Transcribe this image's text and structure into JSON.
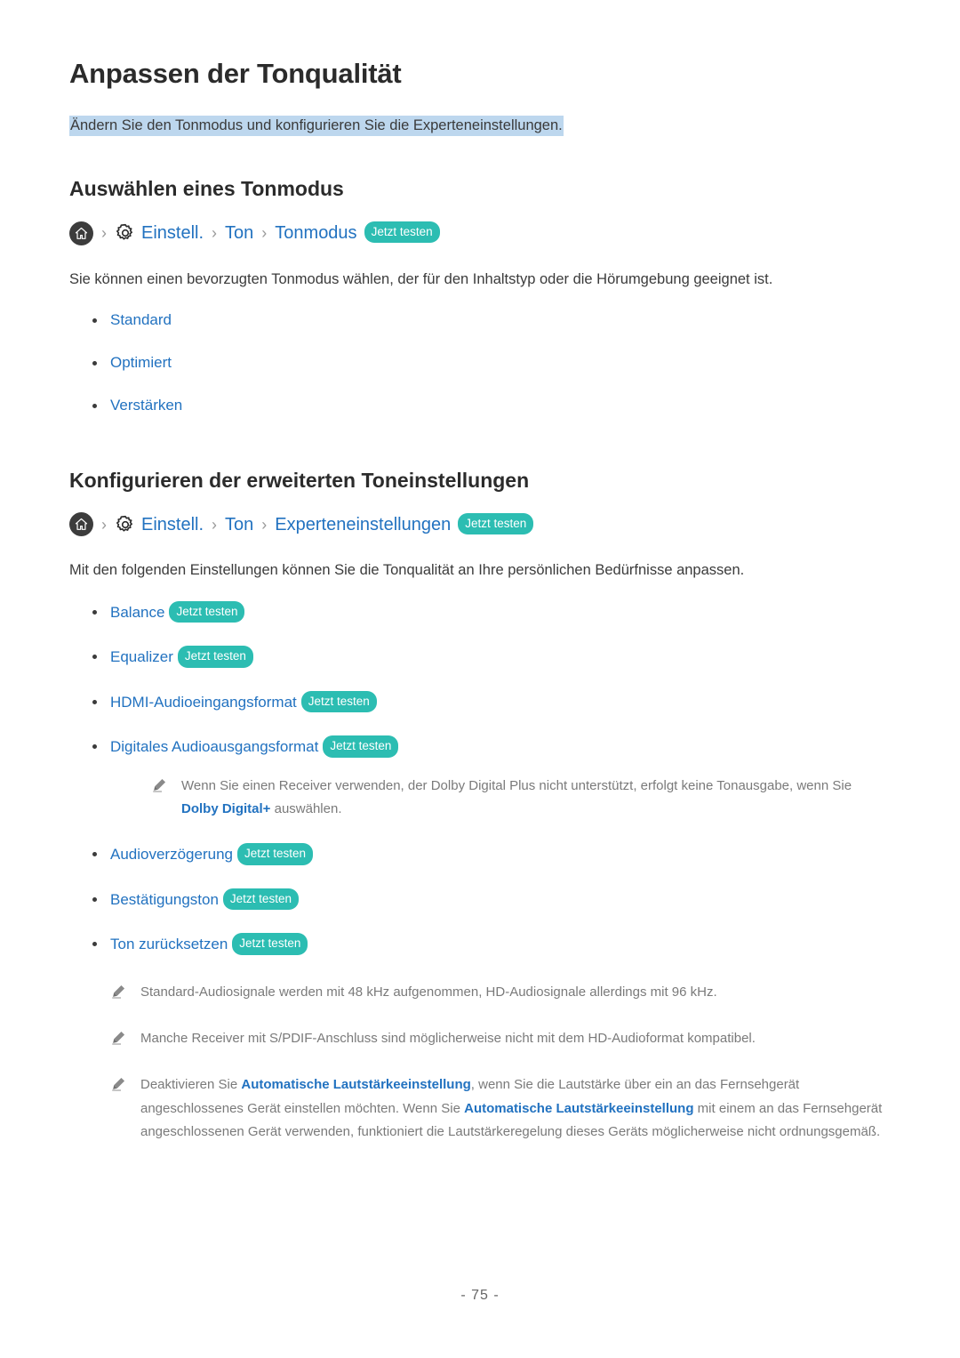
{
  "document": {
    "title": "Anpassen der Tonqualität",
    "subtitle": "Ändern Sie den Tonmodus und konfigurieren Sie die Experteneinstellungen.",
    "page_number": "- 75 -"
  },
  "sections": [
    {
      "heading": "Auswählen eines Tonmodus",
      "breadcrumb": {
        "home_icon": "home-icon",
        "gear_icon": "gear-icon",
        "separator": "›",
        "item1": "Einstell.",
        "item2": "Ton",
        "item3": "Tonmodus",
        "pill": "Jetzt testen"
      },
      "paragraph": "Sie können einen bevorzugten Tonmodus wählen, der für den Inhaltstyp oder die Hörumgebung geeignet ist.",
      "bullets": [
        {
          "label": "Standard"
        },
        {
          "label": "Optimiert"
        },
        {
          "label": "Verstärken"
        }
      ]
    },
    {
      "heading": "Konfigurieren der erweiterten Toneinstellungen",
      "breadcrumb": {
        "home_icon": "home-icon",
        "gear_icon": "gear-icon",
        "separator": "›",
        "item1": "Einstell.",
        "item2": "Ton",
        "item3": "Experteneinstellungen",
        "pill": "Jetzt testen"
      },
      "paragraph": "Mit den folgenden Einstellungen können Sie die Tonqualität an Ihre persönlichen Bedürfnisse anpassen.",
      "bullets": [
        {
          "label": "Balance",
          "pill": "Jetzt testen"
        },
        {
          "label": "Equalizer",
          "pill": "Jetzt testen"
        },
        {
          "label": "HDMI-Audioeingangsformat",
          "pill": "Jetzt testen"
        },
        {
          "label": "Digitales Audioausgangsformat",
          "pill": "Jetzt testen"
        },
        {
          "label": "Audioverzögerung",
          "pill": "Jetzt testen"
        },
        {
          "label": "Bestätigungston",
          "pill": "Jetzt testen"
        },
        {
          "label": "Ton zurücksetzen",
          "pill": "Jetzt testen"
        }
      ],
      "inline_note": {
        "icon": "pencil-icon",
        "text_before": "Wenn Sie einen Receiver verwenden, der Dolby Digital Plus nicht unterstützt, erfolgt keine Tonausgabe, wenn Sie ",
        "highlight": "Dolby Digital+",
        "text_after": " auswählen."
      },
      "notes": [
        {
          "icon": "pencil-icon",
          "text": "Standard-Audiosignale werden mit 48 kHz aufgenommen, HD-Audiosignale allerdings mit 96 kHz."
        },
        {
          "icon": "pencil-icon",
          "text": "Manche Receiver mit S/PDIF-Anschluss sind möglicherweise nicht mit dem HD-Audioformat kompatibel."
        },
        {
          "icon": "pencil-icon",
          "text_p1": "Deaktivieren Sie ",
          "highlight1": "Automatische Lautstärkeeinstellung",
          "text_p2": ", wenn Sie die Lautstärke über ein an das Fernsehgerät angeschlossenes Gerät einstellen möchten. Wenn Sie ",
          "highlight2": "Automatische Lautstärkeeinstellung",
          "text_p3": " mit einem an das Fernsehgerät angeschlossenen Gerät verwenden, funktioniert die Lautstärkeregelung dieses Geräts möglicherweise nicht ordnungsgemäß."
        }
      ]
    }
  ],
  "colors": {
    "link_blue": "#2272c0",
    "pill_teal": "#2cbdb2",
    "highlight_blue": "#bdd7ee",
    "body_text": "#3b3b3b",
    "note_text": "#7a7a7a"
  }
}
